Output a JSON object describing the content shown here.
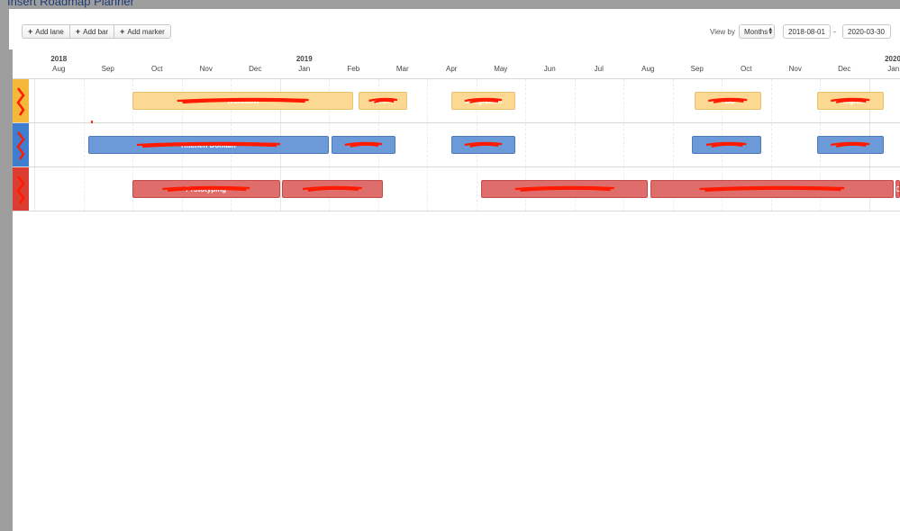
{
  "window": {
    "title": "Insert Roadmap Planner"
  },
  "toolbar": {
    "add_lane": "Add lane",
    "add_bar": "Add bar",
    "add_marker": "Add marker"
  },
  "controls": {
    "view_by_label": "View by",
    "view_by_value": "Months",
    "date_start": "2018-08-01",
    "date_separator": "-",
    "date_end": "2020-03-30"
  },
  "timeline": {
    "years": [
      "2018",
      "2019",
      "2020"
    ],
    "months": [
      "Aug",
      "Sep",
      "Oct",
      "Nov",
      "Dec",
      "Jan",
      "Feb",
      "Mar",
      "Apr",
      "May",
      "Jun",
      "Jul",
      "Aug",
      "Sep",
      "Oct",
      "Nov",
      "Dec",
      "Jan"
    ]
  },
  "lanes": [
    {
      "color": "#f4b83a",
      "bars": [
        {
          "label": "Workflow",
          "start": 2,
          "end": 6.5
        },
        {
          "label": "Eve...",
          "start": 6.6,
          "end": 7.6
        },
        {
          "label": "Integration",
          "start": 8.5,
          "end": 9.8
        },
        {
          "label": "TBD",
          "start": 13.45,
          "end": 14.8
        },
        {
          "label": "Integrati",
          "start": 15.95,
          "end": 17.3
        }
      ]
    },
    {
      "color": "#3f7ecf",
      "bars": [
        {
          "label": "Kitchen Domain",
          "start": 1.1,
          "end": 6
        },
        {
          "label": "",
          "start": 6.05,
          "end": 7.35
        },
        {
          "label": "",
          "start": 8.5,
          "end": 9.8
        },
        {
          "label": "",
          "start": 13.4,
          "end": 14.8
        },
        {
          "label": "",
          "start": 15.95,
          "end": 17.3
        }
      ]
    },
    {
      "color": "#dc3d33",
      "bars": [
        {
          "label": "Prototyping",
          "start": 2,
          "end": 5
        },
        {
          "label": "",
          "start": 5.05,
          "end": 7.1
        },
        {
          "label": "",
          "start": 9.1,
          "end": 12.5
        },
        {
          "label": "",
          "start": 12.55,
          "end": 17.5
        },
        {
          "label": "C",
          "start": 17.55,
          "end": 18
        }
      ]
    }
  ]
}
